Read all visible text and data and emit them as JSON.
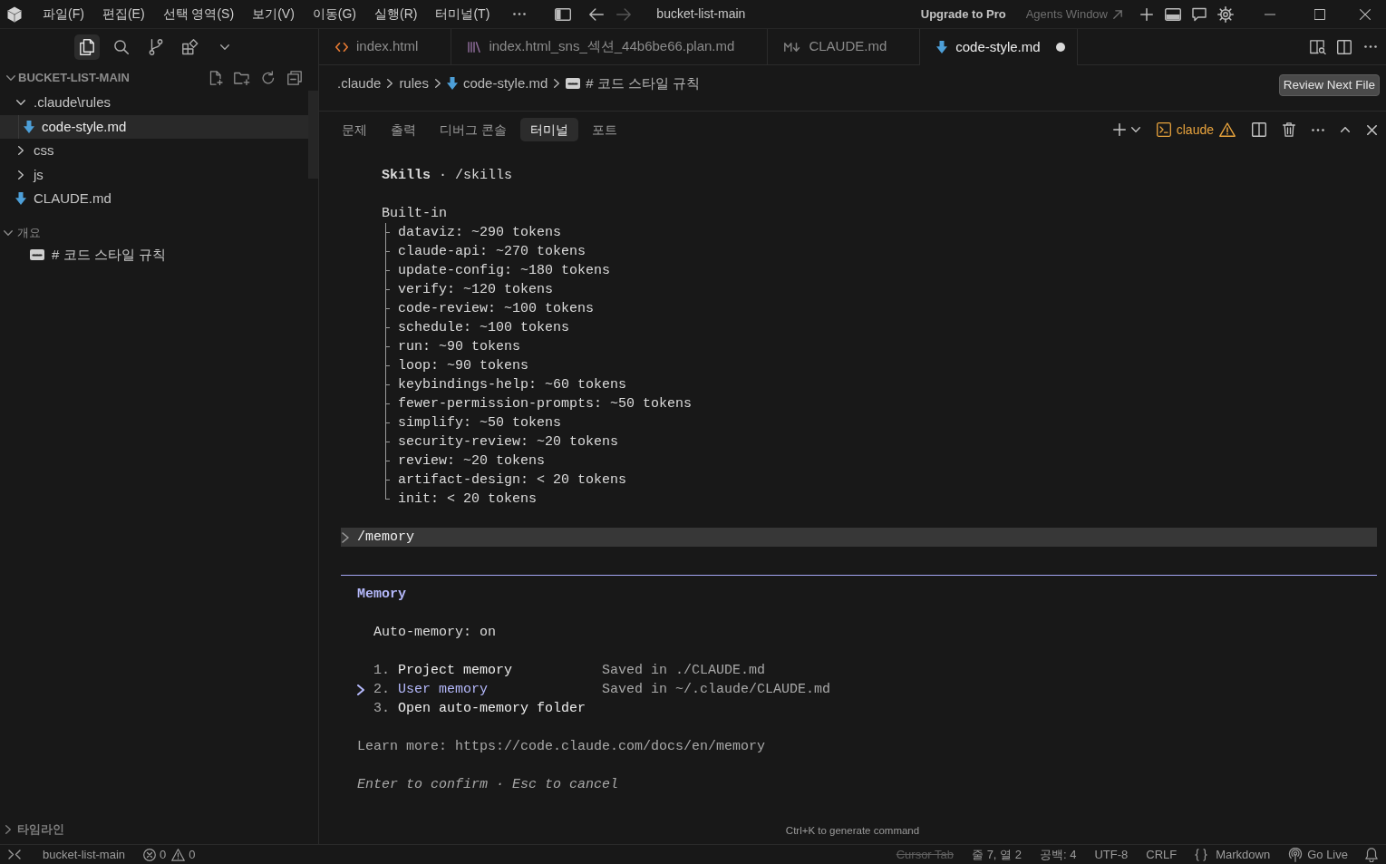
{
  "title_bar": {
    "menu": [
      "파일(F)",
      "편집(E)",
      "선택 영역(S)",
      "보기(V)",
      "이동(G)",
      "실행(R)",
      "터미널(T)"
    ],
    "title": "bucket-list-main",
    "upgrade": "Upgrade to Pro",
    "agents_window": "Agents Window"
  },
  "activity_bar": [
    {
      "kind": "explorer",
      "selected": true
    },
    {
      "kind": "search",
      "selected": false
    },
    {
      "kind": "source_control",
      "selected": false
    },
    {
      "kind": "extensions",
      "selected": false
    }
  ],
  "explorer": {
    "title": "BUCKET-LIST-MAIN",
    "expanded": true,
    "tree": [
      {
        "label": ".claude\\rules",
        "kind": "folder",
        "expanded": true,
        "selected": false,
        "children": [
          {
            "label": "code-style.md",
            "kind": "markdown",
            "selected": true
          }
        ]
      },
      {
        "label": "css",
        "kind": "folder",
        "expanded": false,
        "selected": false
      },
      {
        "label": "js",
        "kind": "folder",
        "expanded": false,
        "selected": false
      },
      {
        "label": "CLAUDE.md",
        "kind": "markdown",
        "selected": false
      }
    ]
  },
  "outline": {
    "title": "개요",
    "expanded": true,
    "items": [
      {
        "label": "# 코드 스타일 규칙",
        "kind": "heading"
      }
    ]
  },
  "timeline": {
    "title": "타임라인",
    "expanded": false
  },
  "editor_tabs": [
    {
      "label": "index.html",
      "kind": "html",
      "selected": false,
      "modified": false
    },
    {
      "label": "index.html_sns_섹션_44b6be66.plan.md",
      "kind": "plan",
      "selected": false,
      "modified": false
    },
    {
      "label": "CLAUDE.md",
      "kind": "markdown_plain",
      "selected": false,
      "modified": false
    },
    {
      "label": "code-style.md",
      "kind": "markdown",
      "selected": true,
      "modified": true
    }
  ],
  "breadcrumbs": [
    {
      "label": ".claude",
      "kind": "folder"
    },
    {
      "label": "rules",
      "kind": "folder"
    },
    {
      "label": "code-style.md",
      "kind": "markdown"
    },
    {
      "label": "# 코드 스타일 규칙",
      "kind": "heading"
    }
  ],
  "review_button": "Review Next File",
  "panel": {
    "tabs": [
      {
        "label": "문제",
        "selected": false
      },
      {
        "label": "출력",
        "selected": false
      },
      {
        "label": "디버그 콘솔",
        "selected": false
      },
      {
        "label": "터미널",
        "selected": true
      },
      {
        "label": "포트",
        "selected": false
      }
    ],
    "terminal_name": "claude",
    "terminal_warning": true,
    "terminal": {
      "skills_heading": "**Skills** · /skills",
      "builtin_label": "Built-in",
      "builtin_skills": [
        "dataviz: ~290 tokens",
        "claude-api: ~270 tokens",
        "update-config: ~180 tokens",
        "verify: ~120 tokens",
        "code-review: ~100 tokens",
        "schedule: ~100 tokens",
        "run: ~90 tokens",
        "loop: ~90 tokens",
        "keybindings-help: ~60 tokens",
        "fewer-permission-prompts: ~50 tokens",
        "simplify: ~50 tokens",
        "security-review: ~20 tokens",
        "review: ~20 tokens",
        "artifact-design: < 20 tokens",
        "init: < 20 tokens"
      ],
      "prompt": "/memory",
      "memory": {
        "title": "Memory",
        "auto_memory": "Auto-memory: on",
        "options": [
          {
            "number": "1.",
            "label": "Project memory",
            "location": "Saved in ./CLAUDE.md",
            "selected": false
          },
          {
            "number": "2.",
            "label": "User memory",
            "location": "Saved in ~/.claude/CLAUDE.md",
            "selected": true
          },
          {
            "number": "3.",
            "label": "Open auto-memory folder",
            "selected": false
          }
        ],
        "learn_more": "Learn more: https://code.claude.com/docs/en/memory",
        "hint": "Enter to confirm · Esc to cancel"
      }
    },
    "command_hint": "Ctrl+K to generate command"
  },
  "status_bar": {
    "workspace": "bucket-list-main",
    "errors": "0",
    "warnings": "0",
    "cursor_tab": {
      "label": "Cursor Tab",
      "disabled": true
    },
    "position": "줄 7, 열 2",
    "indent": "공백: 4",
    "encoding": "UTF-8",
    "line_ending": "CRLF",
    "language": "Markdown",
    "go_live": "Go Live"
  }
}
